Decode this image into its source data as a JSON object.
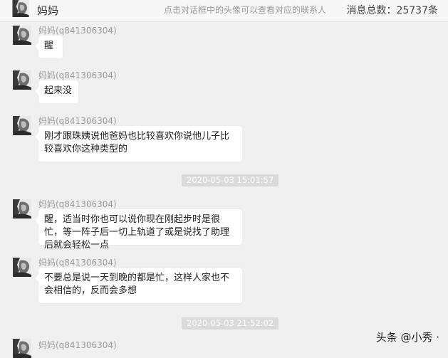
{
  "header": {
    "contact_name": "妈妈",
    "hint": "点击对话框中的头像可以查看对应的联系人",
    "message_count": "消息总数：25737条"
  },
  "messages": [
    {
      "sender": "妈妈(q841306304)",
      "text": "醒"
    },
    {
      "sender": "妈妈(q841306304)",
      "text": "起来没"
    },
    {
      "sender": "妈妈(q841306304)",
      "text": "刚才跟珠姨说他爸妈也比较喜欢你说他儿子比较喜欢你这种类型的"
    },
    {
      "sender": "妈妈(q841306304)",
      "text": "醒，适当时你也可以说你现在刚起步时是很忙，等一阵子后一切上轨道了或是说找了助理后就会轻松一点"
    },
    {
      "sender": "妈妈(q841306304)",
      "text": "不要总是说一天到晚的都是忙，这样人家也不会相信的，反而会多想"
    },
    {
      "sender": "妈妈(q841306304)",
      "text": ""
    }
  ],
  "timestamps": [
    "2020-05-03 15:01:57",
    "2020-05-03 21:52:02"
  ],
  "watermark": "头条 @小秀 ·"
}
